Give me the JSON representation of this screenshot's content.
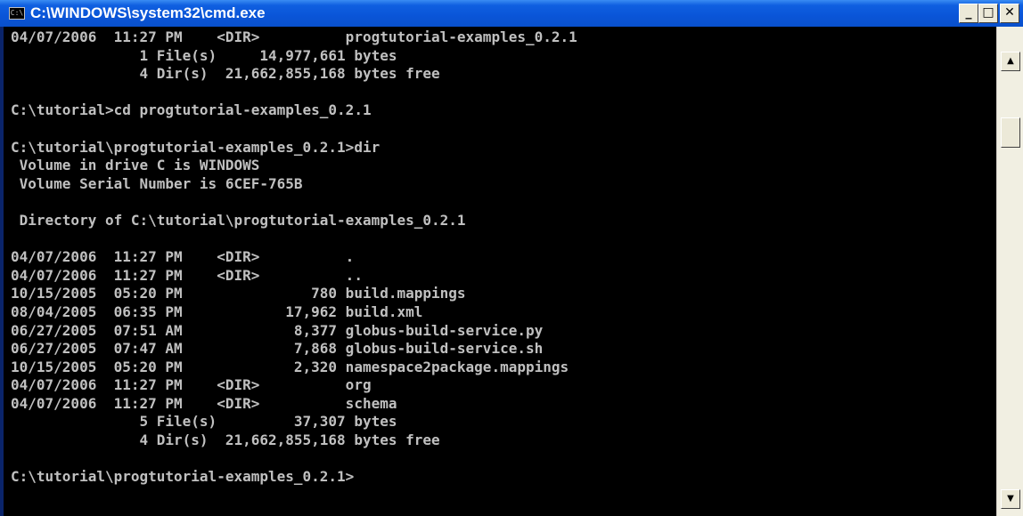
{
  "window": {
    "title": "C:\\WINDOWS\\system32\\cmd.exe",
    "icon_text": "C:\\",
    "minimize_glyph": "_",
    "maximize_glyph": "□",
    "close_glyph": "✕"
  },
  "scrollbar": {
    "up_glyph": "▲",
    "down_glyph": "▼"
  },
  "console": {
    "lines": [
      "04/07/2006  11:27 PM    <DIR>          progtutorial-examples_0.2.1",
      "               1 File(s)     14,977,661 bytes",
      "               4 Dir(s)  21,662,855,168 bytes free",
      "",
      "C:\\tutorial>cd progtutorial-examples_0.2.1",
      "",
      "C:\\tutorial\\progtutorial-examples_0.2.1>dir",
      " Volume in drive C is WINDOWS",
      " Volume Serial Number is 6CEF-765B",
      "",
      " Directory of C:\\tutorial\\progtutorial-examples_0.2.1",
      "",
      "04/07/2006  11:27 PM    <DIR>          .",
      "04/07/2006  11:27 PM    <DIR>          ..",
      "10/15/2005  05:20 PM               780 build.mappings",
      "08/04/2005  06:35 PM            17,962 build.xml",
      "06/27/2005  07:51 AM             8,377 globus-build-service.py",
      "06/27/2005  07:47 AM             7,868 globus-build-service.sh",
      "10/15/2005  05:20 PM             2,320 namespace2package.mappings",
      "04/07/2006  11:27 PM    <DIR>          org",
      "04/07/2006  11:27 PM    <DIR>          schema",
      "               5 File(s)         37,307 bytes",
      "               4 Dir(s)  21,662,855,168 bytes free",
      "",
      "C:\\tutorial\\progtutorial-examples_0.2.1>"
    ]
  }
}
